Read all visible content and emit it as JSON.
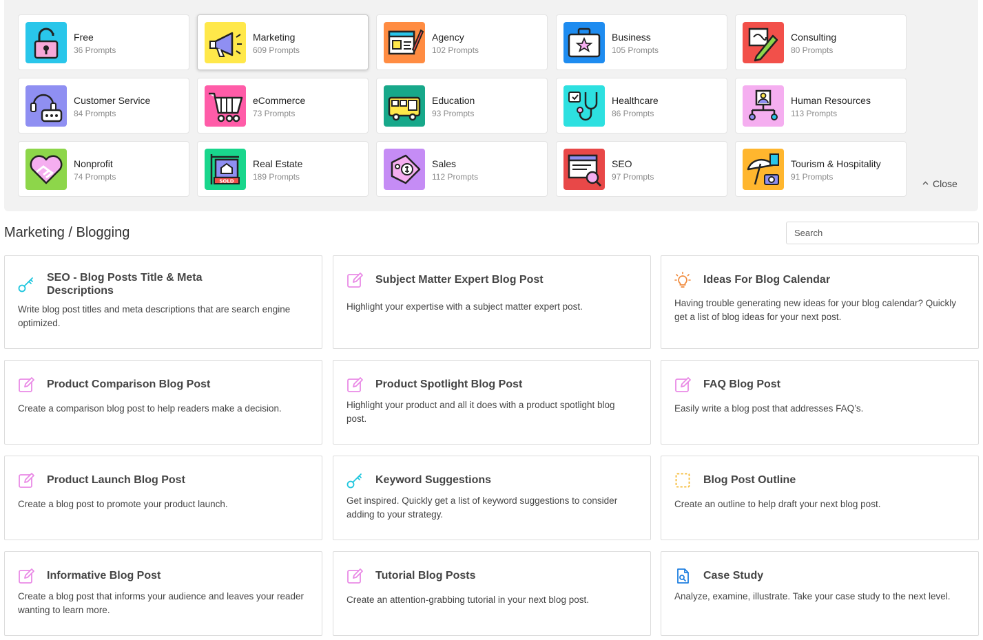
{
  "categories": [
    {
      "name": "Free",
      "count": "36 Prompts"
    },
    {
      "name": "Marketing",
      "count": "609 Prompts"
    },
    {
      "name": "Agency",
      "count": "102 Prompts"
    },
    {
      "name": "Business",
      "count": "105 Prompts"
    },
    {
      "name": "Consulting",
      "count": "80 Prompts"
    },
    {
      "name": "Customer Service",
      "count": "84 Prompts"
    },
    {
      "name": "eCommerce",
      "count": "73 Prompts"
    },
    {
      "name": "Education",
      "count": "93 Prompts"
    },
    {
      "name": "Healthcare",
      "count": "86 Prompts"
    },
    {
      "name": "Human Resources",
      "count": "113 Prompts"
    },
    {
      "name": "Nonprofit",
      "count": "74 Prompts"
    },
    {
      "name": "Real Estate",
      "count": "189 Prompts"
    },
    {
      "name": "Sales",
      "count": "112 Prompts"
    },
    {
      "name": "SEO",
      "count": "97 Prompts"
    },
    {
      "name": "Tourism & Hospitality",
      "count": "91 Prompts"
    }
  ],
  "category_icon_colors": {
    "free": "#29c6ea",
    "marketing": "#ffe84a",
    "agency": "#ff8c42",
    "business": "#1e8cf0",
    "consulting": "#f2504a",
    "customer_service": "#8f8ff2",
    "ecommerce": "#ff5ca8",
    "education": "#17a88a",
    "healthcare": "#2de0e0",
    "human_resources": "#f5aef0",
    "nonprofit": "#8dd64a",
    "real_estate": "#19d68c",
    "sales": "#c58cf5",
    "seo": "#e84848",
    "tourism": "#ffb62e"
  },
  "real_estate_sign": "SOLD",
  "close_label": "Close",
  "breadcrumb": "Marketing / Blogging",
  "search": {
    "placeholder": "Search",
    "value": ""
  },
  "icon_colors": {
    "pen": "#e98ae6",
    "key": "#1fc6de",
    "bulb": "#f08a3c",
    "outline": "#f5b82e",
    "doc": "#1f7fe0"
  },
  "templates": [
    {
      "title": "SEO - Blog Posts Title & Meta Descriptions",
      "desc": "Write blog post titles and meta descriptions that are search engine optimized.",
      "icon": "key-icon"
    },
    {
      "title": "Subject Matter Expert Blog Post",
      "desc": "Highlight your expertise with a subject matter expert post.",
      "icon": "pen-icon"
    },
    {
      "title": "Ideas For Blog Calendar",
      "desc": "Having trouble generating new ideas for your blog calendar? Quickly get a list of blog ideas for your next post.",
      "icon": "lightbulb-icon"
    },
    {
      "title": "Product Comparison Blog Post",
      "desc": "Create a comparison blog post to help readers make a decision.",
      "icon": "pen-icon"
    },
    {
      "title": "Product Spotlight Blog Post",
      "desc": "Highlight your product and all it does with a product spotlight blog post.",
      "icon": "pen-icon"
    },
    {
      "title": "FAQ Blog Post",
      "desc": "Easily write a blog post that addresses FAQ’s.",
      "icon": "pen-icon"
    },
    {
      "title": "Product Launch Blog Post",
      "desc": "Create a blog post to promote your product launch.",
      "icon": "pen-icon"
    },
    {
      "title": "Keyword Suggestions",
      "desc": "Get inspired. Quickly get a list of keyword suggestions to consider adding to your strategy.",
      "icon": "key-icon"
    },
    {
      "title": "Blog Post Outline",
      "desc": "Create an outline to help draft your next blog post.",
      "icon": "outline-icon"
    },
    {
      "title": "Informative Blog Post",
      "desc": "Create a blog post that informs your audience and leaves your reader wanting to learn more.",
      "icon": "pen-icon"
    },
    {
      "title": "Tutorial Blog Posts",
      "desc": "Create an attention-grabbing tutorial in your next blog post.",
      "icon": "pen-icon"
    },
    {
      "title": "Case Study",
      "desc": "Analyze, examine, illustrate. Take your case study to the next level.",
      "icon": "document-search-icon"
    }
  ]
}
